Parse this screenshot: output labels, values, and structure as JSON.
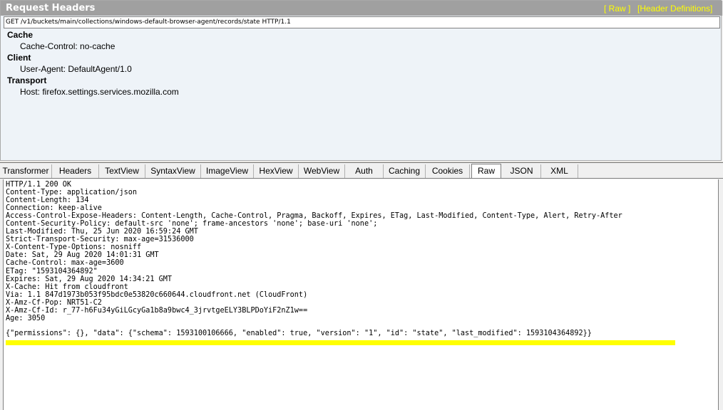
{
  "request_panel": {
    "title": "Request Headers",
    "raw_link": "[ Raw ]",
    "header_definitions_link": "[Header Definitions]",
    "request_line": "GET /v1/buckets/main/collections/windows-default-browser-agent/records/state HTTP/1.1",
    "groups": [
      {
        "label": "Cache",
        "items": [
          "Cache-Control: no-cache"
        ]
      },
      {
        "label": "Client",
        "items": [
          "User-Agent: DefaultAgent/1.0"
        ]
      },
      {
        "label": "Transport",
        "items": [
          "Host: firefox.settings.services.mozilla.com"
        ]
      }
    ]
  },
  "tabs": [
    "Transformer",
    "Headers",
    "TextView",
    "SyntaxView",
    "ImageView",
    "HexView",
    "WebView",
    "Auth",
    "Caching",
    "Cookies",
    "Raw",
    "JSON",
    "XML"
  ],
  "active_tab": "Raw",
  "response": {
    "headers": [
      "HTTP/1.1 200 OK",
      "Content-Type: application/json",
      "Content-Length: 134",
      "Connection: keep-alive",
      "Access-Control-Expose-Headers: Content-Length, Cache-Control, Pragma, Backoff, Expires, ETag, Last-Modified, Content-Type, Alert, Retry-After",
      "Content-Security-Policy: default-src 'none'; frame-ancestors 'none'; base-uri 'none';",
      "Last-Modified: Thu, 25 Jun 2020 16:59:24 GMT",
      "Strict-Transport-Security: max-age=31536000",
      "X-Content-Type-Options: nosniff",
      "Date: Sat, 29 Aug 2020 14:01:31 GMT",
      "Cache-Control: max-age=3600",
      "ETag: \"1593104364892\"",
      "Expires: Sat, 29 Aug 2020 14:34:21 GMT",
      "X-Cache: Hit from cloudfront",
      "Via: 1.1 847d1973b053f95bdc0e53820c660644.cloudfront.net (CloudFront)",
      "X-Amz-Cf-Pop: NRT51-C2",
      "X-Amz-Cf-Id: r_77-h6Fu34yGiLGcyGa1b8a9bwc4_3jrvtgeELY3BLPDoYiF2nZ1w==",
      "Age: 3050"
    ],
    "body": "{\"permissions\": {}, \"data\": {\"schema\": 1593100106666, \"enabled\": true, \"version\": \"1\", \"id\": \"state\", \"last_modified\": 1593104364892}}"
  },
  "colors": {
    "title_bar": "#a0a0a0",
    "title_links": "#ffff00",
    "request_panel_bg": "#eef3f8",
    "highlight": "#ffff00"
  }
}
